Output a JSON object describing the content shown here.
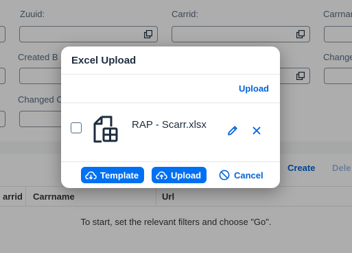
{
  "filter_bar": {
    "labels": {
      "zuuid": "Zuuid:",
      "carrid": "Carrid:",
      "carrname": "Carrname",
      "created_by": "Created B",
      "changed_by": "Change",
      "changed_on": "Changed C"
    },
    "value_help_icon": "value-help-icon"
  },
  "table": {
    "toolbar": {
      "create_label": "Create",
      "delete_label": "Dele"
    },
    "columns": [
      "arrid",
      "Carrname",
      "Url"
    ],
    "no_data_text": "To start, set the relevant filters and choose \"Go\"."
  },
  "dialog": {
    "title": "Excel Upload",
    "upload_link_label": "Upload",
    "file": {
      "name": "RAP - Scarr.xlsx",
      "icon": "excel-attachment-icon",
      "checked": false
    },
    "footer": {
      "template_label": "Template",
      "upload_label": "Upload",
      "cancel_label": "Cancel"
    }
  },
  "colors": {
    "brand": "#0070f2",
    "link": "#0064d9",
    "text": "#1d2d3e",
    "label": "#556b82",
    "disabled_link": "#9cbde6"
  }
}
